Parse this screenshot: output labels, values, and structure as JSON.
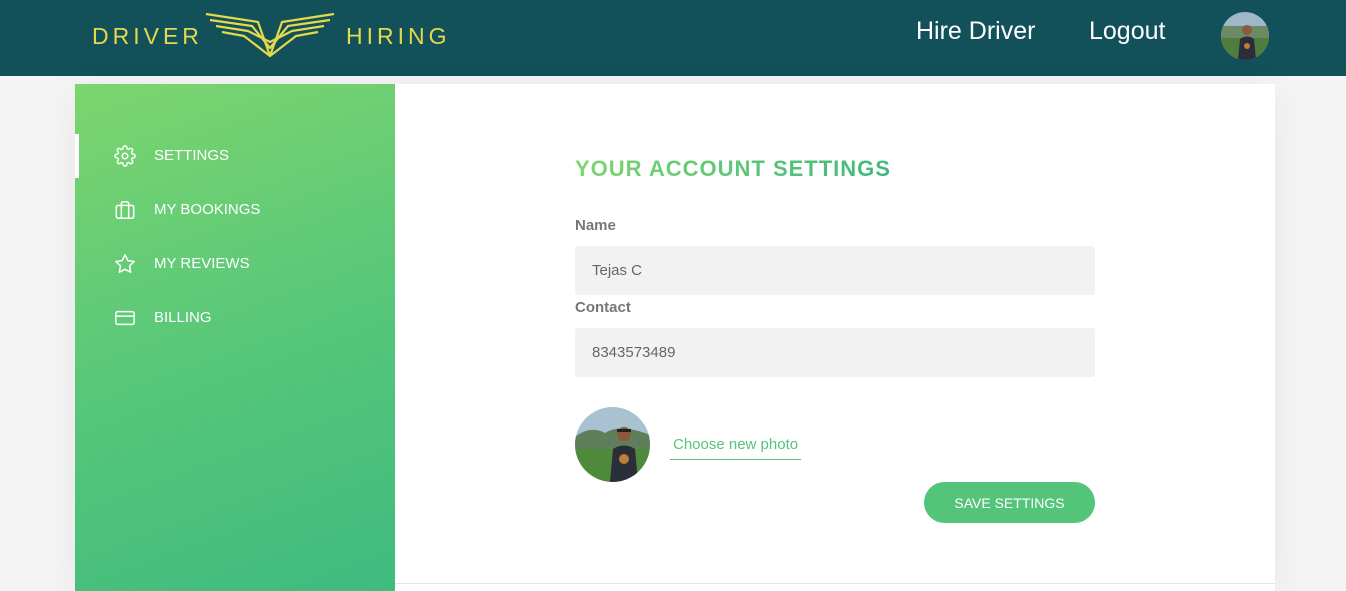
{
  "brand": {
    "left_word": "DRIVER",
    "right_word": "HIRING",
    "color": "#e4d84c",
    "icon": "wings-logo-icon"
  },
  "nav": {
    "hire_driver": "Hire Driver",
    "logout": "Logout",
    "avatar_icon": "user-avatar"
  },
  "colors": {
    "header_bg": "#12505a",
    "accent_green": "#55c47b",
    "gradient_start": "#7cd56e",
    "gradient_end": "#3fbb7e"
  },
  "sidebar": {
    "items": [
      {
        "label": "Settings",
        "icon": "gear-icon",
        "active": true
      },
      {
        "label": "My bookings",
        "icon": "briefcase-icon",
        "active": false
      },
      {
        "label": "My reviews",
        "icon": "star-icon",
        "active": false
      },
      {
        "label": "Billing",
        "icon": "credit-card-icon",
        "active": false
      }
    ]
  },
  "settings": {
    "heading": "Your account settings",
    "name_label": "Name",
    "name_value": "Tejas C",
    "contact_label": "Contact",
    "contact_value": "8343573489",
    "choose_photo": "Choose new photo",
    "save_button": "Save settings"
  }
}
